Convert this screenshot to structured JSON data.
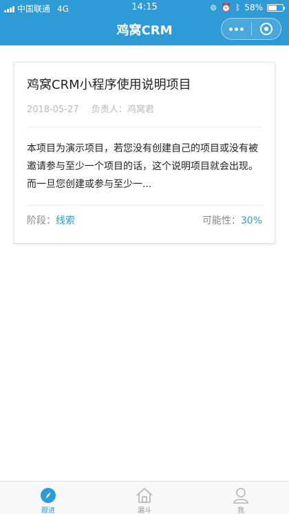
{
  "status_bar": {
    "carrier": "中国联通",
    "network": "4G",
    "time": "14:15",
    "battery": "58%",
    "battery_level": 0.58
  },
  "header": {
    "title": "鸡窝CRM",
    "menu_icon": "more-dots-icon",
    "close_icon": "target-icon"
  },
  "project_card": {
    "title": "鸡窝CRM小程序使用说明项目",
    "date": "2018-05-27",
    "owner_label": "负责人：",
    "owner": "鸡窝君",
    "description": "本项目为演示项目，若您没有创建自己的项目或没有被邀请参与至少一个项目的话，这个说明项目就会出现。而一旦您创建或参与至少一...",
    "stage_label": "阶段：",
    "stage": "线索",
    "probability_label": "可能性：",
    "probability": "30%"
  },
  "tabbar": {
    "tabs": [
      {
        "label": "跟进",
        "icon": "compass-icon",
        "active": true
      },
      {
        "label": "漏斗",
        "icon": "home-icon",
        "active": false
      },
      {
        "label": "我",
        "icon": "user-icon",
        "active": false
      }
    ]
  },
  "colors": {
    "primary": "#2f9bd6",
    "text": "#222222",
    "muted": "#bbbbbb"
  }
}
